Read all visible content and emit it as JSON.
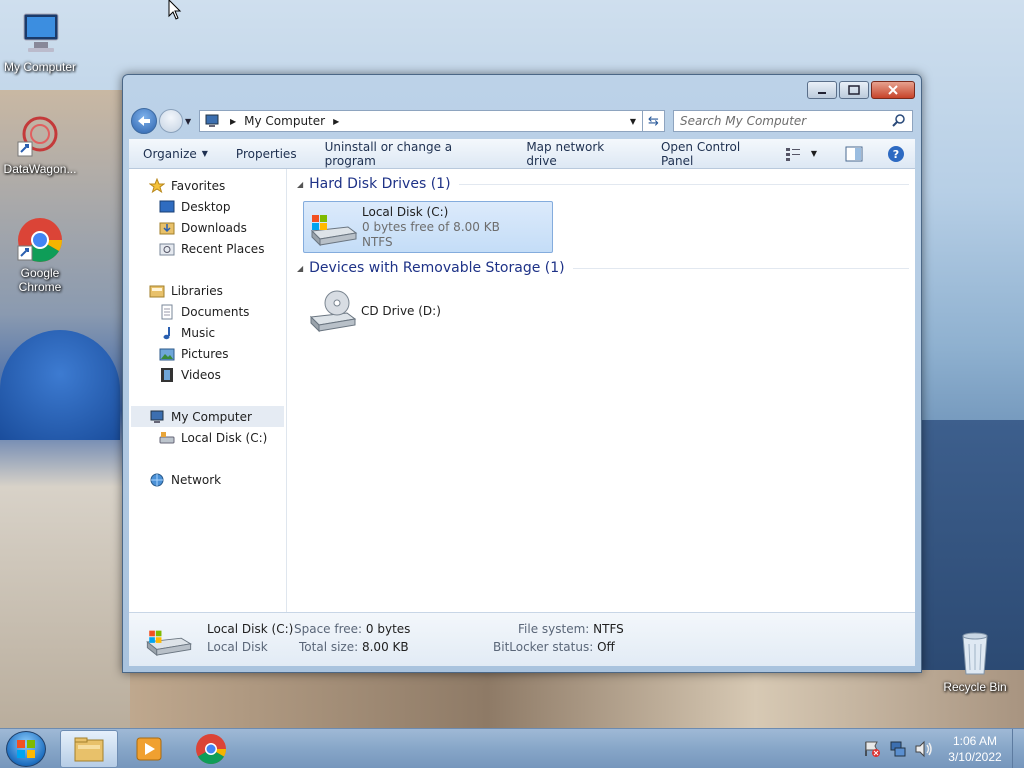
{
  "desktop": {
    "icons": [
      {
        "label": "My Computer"
      },
      {
        "label": "DataWagon..."
      },
      {
        "label": "Google Chrome"
      },
      {
        "label": "Recycle Bin"
      }
    ]
  },
  "window": {
    "address": {
      "path": [
        "My Computer"
      ],
      "search_placeholder": "Search My Computer"
    },
    "toolbar": {
      "organize": "Organize",
      "properties": "Properties",
      "uninstall": "Uninstall or change a program",
      "map_drive": "Map network drive",
      "control_panel": "Open Control Panel"
    },
    "nav": {
      "favorites": "Favorites",
      "desktop": "Desktop",
      "downloads": "Downloads",
      "recent": "Recent Places",
      "libraries": "Libraries",
      "documents": "Documents",
      "music": "Music",
      "pictures": "Pictures",
      "videos": "Videos",
      "computer": "My Computer",
      "local_disk": "Local Disk (C:)",
      "network": "Network"
    },
    "groups": {
      "hdd_header": "Hard Disk Drives (1)",
      "removable_header": "Devices with Removable Storage (1)"
    },
    "drives": {
      "c_name": "Local Disk (C:)",
      "c_free": "0 bytes free of 8.00 KB",
      "c_fs": "NTFS",
      "d_name": "CD Drive (D:)"
    },
    "details": {
      "name": "Local Disk (C:)",
      "type": "Local Disk",
      "space_free_label": "Space free:",
      "space_free_value": "0 bytes",
      "total_size_label": "Total size:",
      "total_size_value": "8.00 KB",
      "fs_label": "File system:",
      "fs_value": "NTFS",
      "bitlocker_label": "BitLocker status:",
      "bitlocker_value": "Off"
    }
  },
  "taskbar": {
    "time": "1:06 AM",
    "date": "3/10/2022"
  }
}
